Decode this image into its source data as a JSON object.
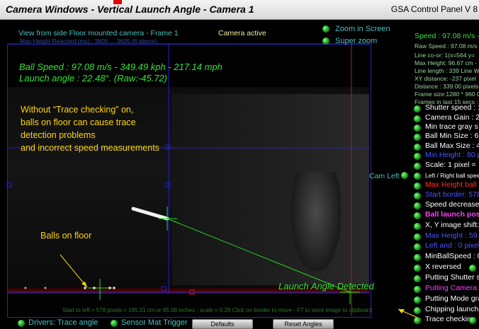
{
  "title_bar": {
    "title": "Camera Windows - Vertical Launch Angle - Camera 1",
    "right_title": "GSA Control Panel V 8"
  },
  "viewport": {
    "caption": "View from side Floor mounted camera -  Frame 1",
    "camera_status": "Camera active",
    "obscured_caption": "Max Height Reached (ms) : 3605 ... 3605 (ft above)",
    "speed_line": "Ball Speed : 97.08 m/s - 349.49 kph - 217.14 mph",
    "angle_line": "Launch angle : 22.48°. (Raw:-45.72)",
    "annotation_lines": [
      "Without “Trace checking” on,",
      "balls on floor can cause trace",
      "detection problems",
      "and incorrect speed measurements"
    ],
    "balls_label": "Balls on floor",
    "detected_label": "Launch Angle Detected",
    "status_bar": "Start to left = 578 pixels = 165.31 cm or 65.08 inches : scale = 0.29 Click on border to move - F7 to store image to clipboard"
  },
  "zoom_controls": {
    "zoom_in_screen": "Zoom in Screen",
    "super_zoom": "Super zoom"
  },
  "cam_left_label": "Cam Left",
  "panel": {
    "speed": "Speed : 97.08 m/s -",
    "raw_speed": "Raw Speed : 97.08 m/s",
    "line_coords": "Line co-or: 1(x=564 y=",
    "max_height": "Max Height: 96.67 cm -",
    "line_length": "Line length : 339 Line W",
    "xy_distance": "XY distance: -237 pixel",
    "distance": "Distance : 339.00 pixels",
    "frame_size": "Frame size:1280 * 960 C",
    "frames_last": "Frames in last 15 secs :",
    "controls": [
      {
        "label": "Shutter speed : 1",
        "color": "#ffffff"
      },
      {
        "label": "Camera Gain : 2",
        "color": "#ffffff"
      },
      {
        "label": "Min trace gray s",
        "color": "#ffffff"
      },
      {
        "label": "Ball Min Size : 6",
        "color": "#ffffff"
      },
      {
        "label": "Ball Max Size : 4",
        "color": "#ffffff"
      },
      {
        "label": "Min Height : 80 p",
        "color": "#4a58ff"
      },
      {
        "label": "Scale: 1 pixel =",
        "color": "#ffffff"
      },
      {
        "label": "Left / Right ball speed",
        "color": "#ffffff"
      },
      {
        "label": "Max Height ball",
        "color": "#ff3030"
      },
      {
        "label": "Start border: 578",
        "color": "#4a58ff"
      },
      {
        "label": "Speed decrease",
        "color": "#ffffff"
      },
      {
        "label": "Ball launch posit",
        "color": "#ff40ff"
      },
      {
        "label": "X, Y image shift:",
        "color": "#ffffff"
      },
      {
        "label": "Max Height : 59",
        "color": "#4a58ff"
      },
      {
        "label": "Left and : 0 pixel",
        "color": "#4a58ff"
      },
      {
        "label": "MinBallSpeed : 0",
        "color": "#ffffff"
      },
      {
        "label": "X reversed",
        "color": "#ffffff"
      },
      {
        "label": "Putting Shutter s",
        "color": "#ffffff"
      },
      {
        "label": "Putting Camera",
        "color": "#ff40ff"
      },
      {
        "label": "Putting Mode gra",
        "color": "#ffffff"
      },
      {
        "label": "Chipping launch",
        "color": "#ffffff"
      },
      {
        "label": "Trace checking",
        "color": "#ffffff"
      }
    ]
  },
  "bottom": {
    "drivers_trace": "Drivers: Trace angle",
    "sensor_mat": "Sensor Mat Trigger",
    "defaults_button": "Defaults",
    "reset_angles_button": "Reset Angles"
  },
  "colors": {
    "accent_green": "#35e235",
    "annotation_yellow": "#ffd700",
    "guide_blue": "#2020d0",
    "trace_green": "#22dd22"
  }
}
